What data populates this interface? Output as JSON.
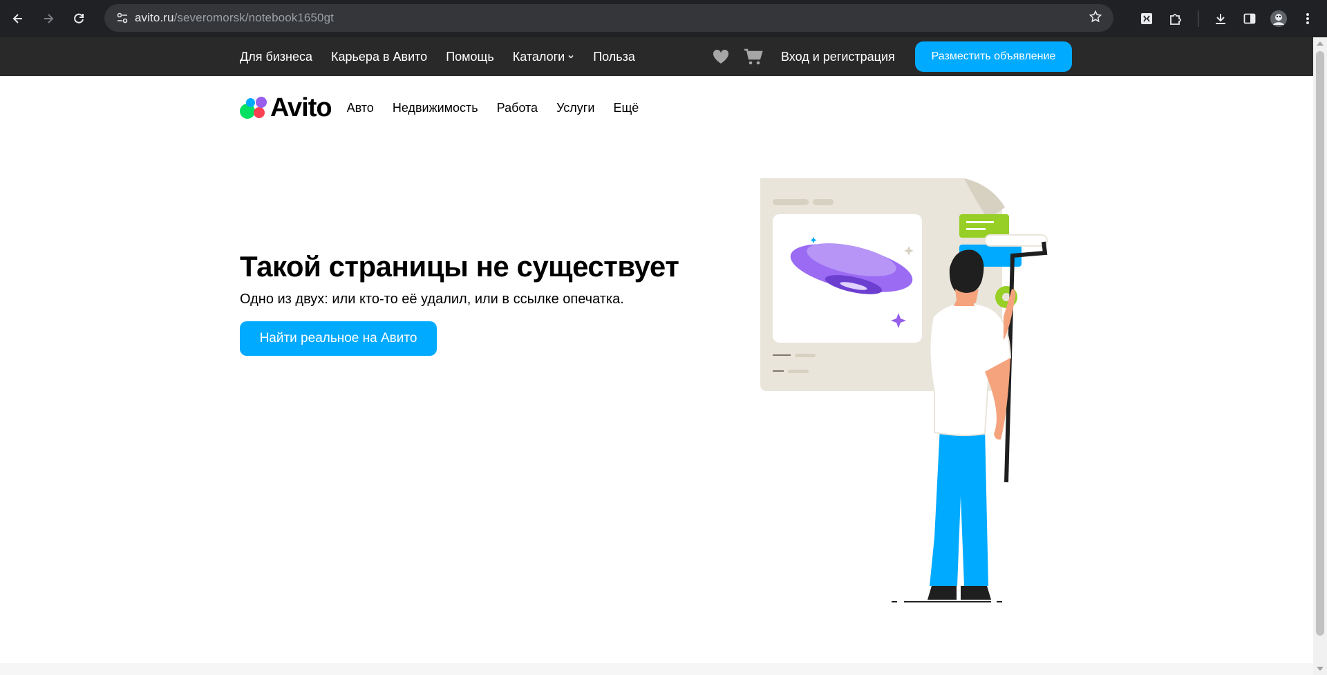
{
  "browser": {
    "url_domain": "avito.ru",
    "url_path": "/severomorsk/notebook1650gt",
    "icons": [
      "back-icon",
      "forward-icon",
      "reload-icon",
      "site-settings-icon",
      "bookmark-star-icon",
      "extension-icon",
      "puzzle-icon",
      "download-icon",
      "side-panel-icon",
      "profile-avatar-icon",
      "menu-icon"
    ]
  },
  "topbar": {
    "links": [
      "Для бизнеса",
      "Карьера в Авито",
      "Помощь",
      "Каталоги",
      "Польза"
    ],
    "login": "Вход и регистрация",
    "post_button": "Разместить объявление"
  },
  "header": {
    "logo_text": "Avito",
    "nav": [
      "Авто",
      "Недвижимость",
      "Работа",
      "Услуги",
      "Ещё"
    ]
  },
  "error": {
    "title": "Такой страницы не существует",
    "subtitle": "Одно из двух: или кто-то её удалил, или в ссылке опечатка.",
    "button": "Найти реальное на Авито"
  },
  "colors": {
    "accent": "#00aaff",
    "topbar_bg": "#292929",
    "logo_green": "#04e061",
    "logo_blue": "#00aaff",
    "logo_red": "#ff4053",
    "logo_purple": "#965eeb"
  }
}
